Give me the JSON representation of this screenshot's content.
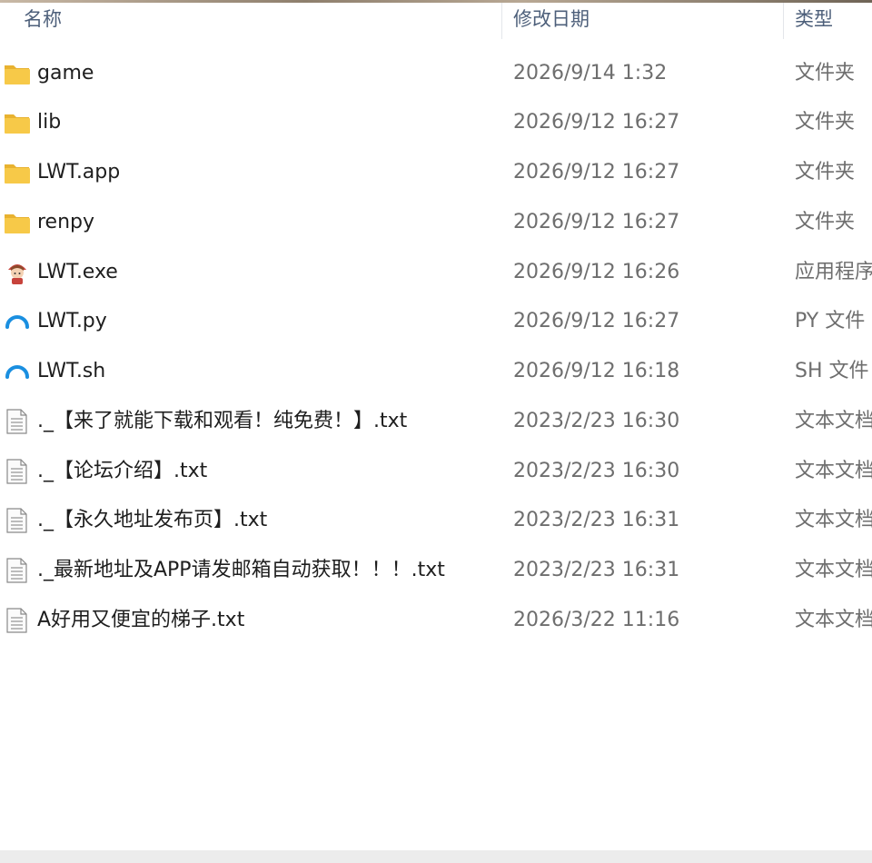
{
  "columns": {
    "name": "名称",
    "modified": "修改日期",
    "type": "类型"
  },
  "files": [
    {
      "name": "game",
      "date": "2026/9/14 1:32",
      "type": "文件夹",
      "icon": "folder-icon"
    },
    {
      "name": "lib",
      "date": "2026/9/12 16:27",
      "type": "文件夹",
      "icon": "folder-icon"
    },
    {
      "name": "LWT.app",
      "date": "2026/9/12 16:27",
      "type": "文件夹",
      "icon": "folder-icon"
    },
    {
      "name": "renpy",
      "date": "2026/9/12 16:27",
      "type": "文件夹",
      "icon": "folder-icon"
    },
    {
      "name": "LWT.exe",
      "date": "2026/9/12 16:26",
      "type": "应用程序",
      "icon": "app-character-icon"
    },
    {
      "name": "LWT.py",
      "date": "2026/9/12 16:27",
      "type": "PY 文件",
      "icon": "circular-arc-icon"
    },
    {
      "name": "LWT.sh",
      "date": "2026/9/12 16:18",
      "type": "SH 文件",
      "icon": "circular-arc-icon"
    },
    {
      "name": "._【来了就能下载和观看！纯免费！】.txt",
      "date": "2023/2/23 16:30",
      "type": "文本文档",
      "icon": "text-document-icon"
    },
    {
      "name": "._【论坛介绍】.txt",
      "date": "2023/2/23 16:30",
      "type": "文本文档",
      "icon": "text-document-icon"
    },
    {
      "name": "._【永久地址发布页】.txt",
      "date": "2023/2/23 16:31",
      "type": "文本文档",
      "icon": "text-document-icon"
    },
    {
      "name": "._最新地址及APP请发邮箱自动获取！！！.txt",
      "date": "2023/2/23 16:31",
      "type": "文本文档",
      "icon": "text-document-icon"
    },
    {
      "name": "A好用又便宜的梯子.txt",
      "date": "2026/3/22 11:16",
      "type": "文本文档",
      "icon": "text-document-icon"
    }
  ],
  "colors": {
    "header_text": "#4d5f7a",
    "name_text": "#1e1e1e",
    "meta_text": "#6e6e6e",
    "folder": "#f7c948",
    "folder_dark": "#e8b230",
    "arc_blue": "#1a8fe0"
  }
}
